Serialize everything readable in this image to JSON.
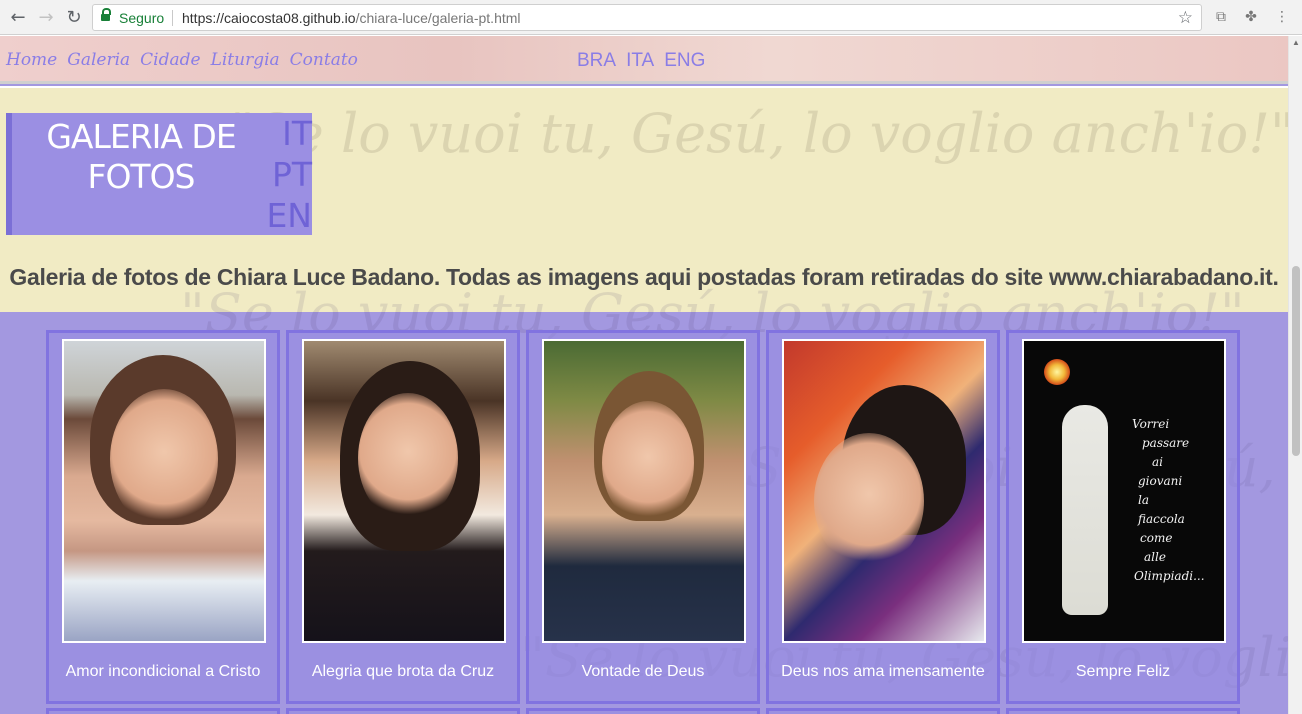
{
  "browser": {
    "secure_label": "Seguro",
    "url_host": "https://caiocosta08.github.io",
    "url_path": "/chiara-luce/galeria-pt.html"
  },
  "site_menu": [
    {
      "label": "Home"
    },
    {
      "label": "Galeria"
    },
    {
      "label": "Cidade"
    },
    {
      "label": "Liturgia"
    },
    {
      "label": "Contato"
    }
  ],
  "top_langs": [
    "BRA",
    "ITA",
    "ENG"
  ],
  "watermark": {
    "line1": "\"Se lo vuoi tu, Gesú, lo voglio anch'io!\""
  },
  "title": {
    "line1": "GALERIA DE",
    "line2": "FOTOS",
    "langs": [
      "IT",
      "PT",
      "EN"
    ]
  },
  "intro": "Galeria de fotos de Chiara Luce Badano. Todas as imagens aqui postadas foram retiradas do site www.chiarabadano.it.",
  "gallery": [
    {
      "caption": "Amor incondicional a Cristo"
    },
    {
      "caption": "Alegria que brota da Cruz"
    },
    {
      "caption": "Vontade de Deus"
    },
    {
      "caption": "Deus nos ama imensamente"
    },
    {
      "caption": "Sempre Feliz"
    }
  ],
  "poem": [
    "Vorrei",
    "passare",
    "ai",
    "giovani",
    "la",
    "fiaccola",
    "come",
    "alle",
    "Olimpiadi..."
  ],
  "colors": {
    "accent": "#8a7de6",
    "panel": "#a398e0",
    "banner": "#f1ebc4",
    "secure": "#188038"
  }
}
